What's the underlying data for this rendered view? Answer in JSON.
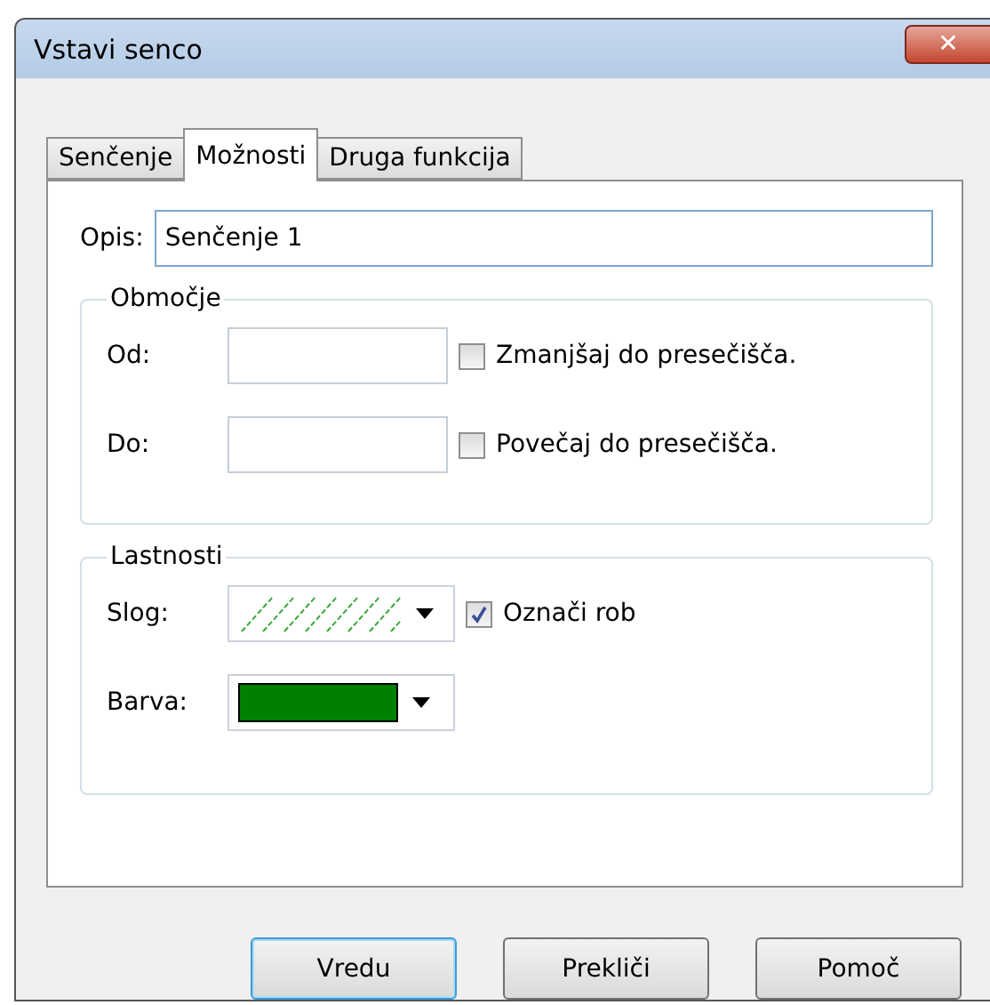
{
  "window": {
    "title": "Vstavi senco",
    "close": "✕"
  },
  "tabs": [
    {
      "label": "Senčenje",
      "selected": false
    },
    {
      "label": "Možnosti",
      "selected": true
    },
    {
      "label": "Druga funkcija",
      "selected": false
    }
  ],
  "description": {
    "label": "Opis:",
    "value": "Senčenje 1"
  },
  "range": {
    "title": "Območje",
    "rows": [
      {
        "label": "Od:",
        "value": "",
        "option": "Zmanjšaj do presečišča.",
        "checked": false
      },
      {
        "label": "Do:",
        "value": "",
        "option": "Povečaj do presečišča.",
        "checked": false
      }
    ]
  },
  "properties": {
    "title": "Lastnosti",
    "style": {
      "label": "Slog:",
      "option": "Označi rob",
      "checked": true
    },
    "color": {
      "label": "Barva:",
      "color": "#008000"
    }
  },
  "buttons": [
    {
      "label": "Vredu",
      "default": true
    },
    {
      "label": "Prekliči",
      "default": false
    },
    {
      "label": "Pomoč",
      "default": false
    }
  ]
}
